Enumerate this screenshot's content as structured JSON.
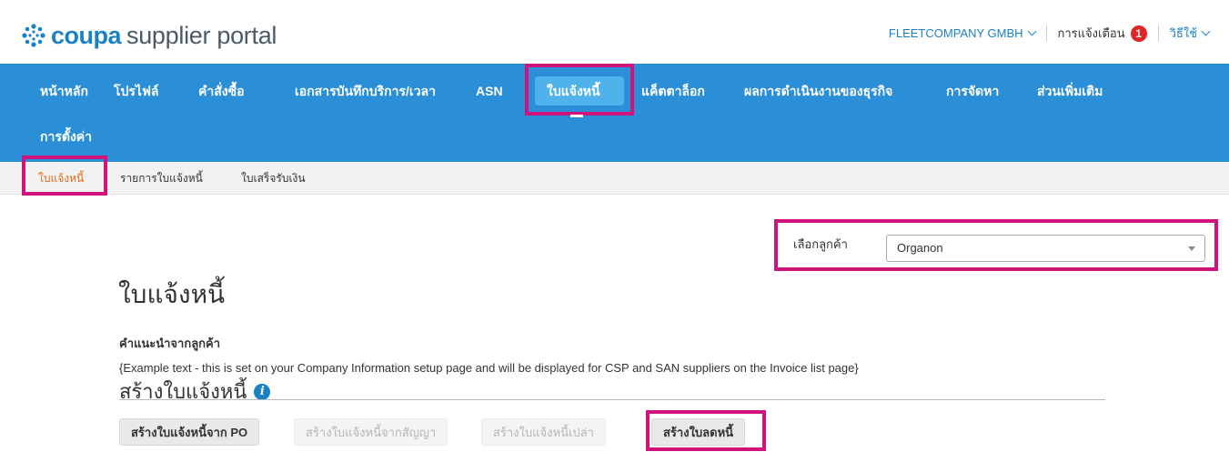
{
  "header": {
    "logo_brand": "coupa",
    "logo_product": "supplier portal",
    "company": "FLEETCOMPANY GMBH",
    "notifications_label": "การแจ้งเตือน",
    "notifications_count": "1",
    "help_label": "วิธีใช้"
  },
  "nav": {
    "items": [
      {
        "label": "หน้าหลัก"
      },
      {
        "label": "โปรไฟล์"
      },
      {
        "label": "คำสั่งซื้อ"
      },
      {
        "label": "เอกสารบันทึกบริการ/เวลา"
      },
      {
        "label": "ASN"
      },
      {
        "label": "ใบแจ้งหนี้"
      },
      {
        "label": "แค็ตตาล็อก"
      },
      {
        "label": "ผลการดำเนินงานของธุรกิจ"
      },
      {
        "label": "การจัดหา"
      },
      {
        "label": "ส่วนเพิ่มเติม"
      },
      {
        "label": "การตั้งค่า"
      }
    ],
    "active": "ใบแจ้งหนี้"
  },
  "subnav": {
    "items": [
      {
        "label": "ใบแจ้งหนี้"
      },
      {
        "label": "รายการใบแจ้งหนี้"
      },
      {
        "label": "ใบเสร็จรับเงิน"
      }
    ]
  },
  "customer_select": {
    "label": "เลือกลูกค้า",
    "value": "Organon"
  },
  "main": {
    "title": "ใบแจ้งหนี้",
    "customer_instructions_title": "คำแนะนำจากลูกค้า",
    "example_text": "{Example text - this is set on your Company Information setup page and will be displayed for CSP and SAN suppliers on the Invoice list page}",
    "create_title": "สร้างใบแจ้งหนี้",
    "buttons": {
      "from_po": "สร้างใบแจ้งหนี้จาก PO",
      "from_contract": "สร้างใบแจ้งหนี้จากสัญญา",
      "blank": "สร้างใบแจ้งหนี้เปล่า",
      "credit_note": "สร้างใบลดหนี้"
    }
  },
  "colors": {
    "nav_background": "#2a8fd6",
    "highlight_border": "#d1137c",
    "brand_blue": "#1a82c4",
    "active_subnav": "#e06a1b"
  },
  "icons": [
    "coupa-logo-icon",
    "chevron-down-icon",
    "info-icon",
    "dropdown-arrow-icon"
  ]
}
